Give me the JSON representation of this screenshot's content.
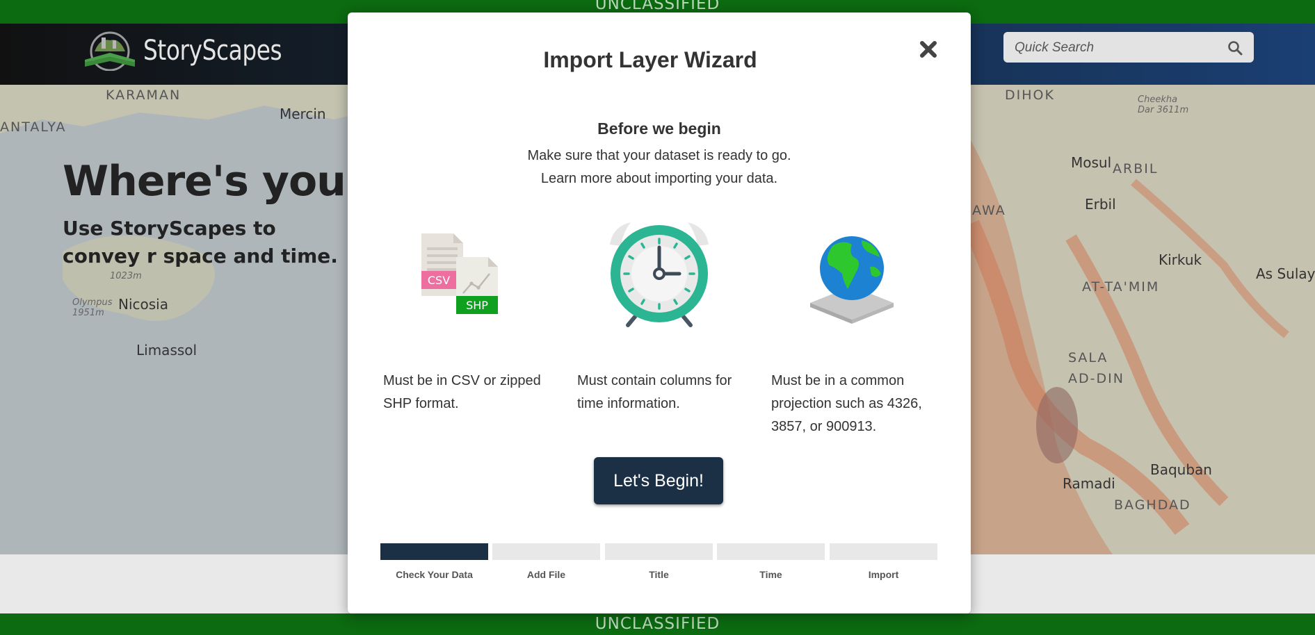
{
  "banner": {
    "top": "UNCLASSIFIED",
    "bottom": "UNCLASSIFIED"
  },
  "header": {
    "logo_text": "StoryScapes",
    "search_placeholder": "Quick Search"
  },
  "hero": {
    "title": "Where's your s",
    "subtitle": "Use StoryScapes to convey r space and time."
  },
  "map_labels": {
    "karaman": "KARAMAN",
    "antalya": "ANTALYA",
    "mercin": "Mercin",
    "nicosia": "Nicosia",
    "limassol": "Limassol",
    "olympus": "Olympus 1951m",
    "peak1": "1023m",
    "dihok": "DIHOK",
    "mosul": "Mosul",
    "arbil": "ARBIL",
    "erbil": "Erbil",
    "awa": "AWA",
    "kirkuk": "Kirkuk",
    "as_sulay": "As Sulay",
    "at_tamim": "AT-TA'MIM",
    "sala": "SALA",
    "ad_din": "AD-DIN",
    "baquban": "Baquban",
    "ramadi": "Ramadi",
    "baghdad": "BAGHDAD",
    "cheekha": "Cheekha Dar 3611m"
  },
  "modal": {
    "title": "Import Layer Wizard",
    "before_title": "Before we begin",
    "intro_line1": "Make sure that your dataset is ready to go.",
    "intro_line2": "Learn more about importing your data.",
    "requirements": [
      {
        "icon": "file-formats-icon",
        "badge1": "CSV",
        "badge2": "SHP",
        "text": "Must be in CSV or zipped SHP format."
      },
      {
        "icon": "alarm-clock-icon",
        "text": "Must contain columns for time information."
      },
      {
        "icon": "globe-icon",
        "text": "Must be in a common projection such as 4326, 3857, or 900913."
      }
    ],
    "begin_button": "Let's Begin!",
    "steps": [
      {
        "label": "Check Your Data",
        "active": true
      },
      {
        "label": "Add File",
        "active": false
      },
      {
        "label": "Title",
        "active": false
      },
      {
        "label": "Time",
        "active": false
      },
      {
        "label": "Import",
        "active": false
      }
    ]
  },
  "colors": {
    "banner": "#0c6a10",
    "primary": "#1b2f45",
    "clock": "#2bb593",
    "csv_badge": "#ec6fa0",
    "shp_badge": "#0fa020"
  }
}
